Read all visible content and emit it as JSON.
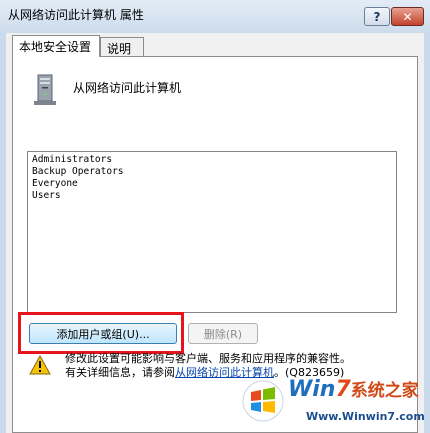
{
  "window": {
    "title": "从网络访问此计算机 属性",
    "help_label": "?",
    "close_label": "✕"
  },
  "tabs": [
    {
      "label": "本地安全设置",
      "active": true
    },
    {
      "label": "说明",
      "active": false
    }
  ],
  "policy": {
    "name": "从网络访问此计算机",
    "icon": "computer-icon"
  },
  "members": [
    "Administrators",
    "Backup Operators",
    "Everyone",
    "Users"
  ],
  "buttons": {
    "add": "添加用户或组(U)...",
    "remove": "删除(R)"
  },
  "warning": {
    "line1": "修改此设置可能影响与客户端、服务和应用程序的兼容性。",
    "line2_prefix": "有关详细信息，请参阅",
    "link": "从网络访问此计算机",
    "line2_suffix": "。(Q823659)",
    "icon": "warning-icon"
  },
  "watermark": {
    "brand_win": "Win",
    "brand_seven": "7",
    "brand_cn": "系统之家",
    "url": "Www.Winwin7.com"
  },
  "colors": {
    "highlight": "#e8141c",
    "link": "#0645ad",
    "close": "#c3432c"
  }
}
